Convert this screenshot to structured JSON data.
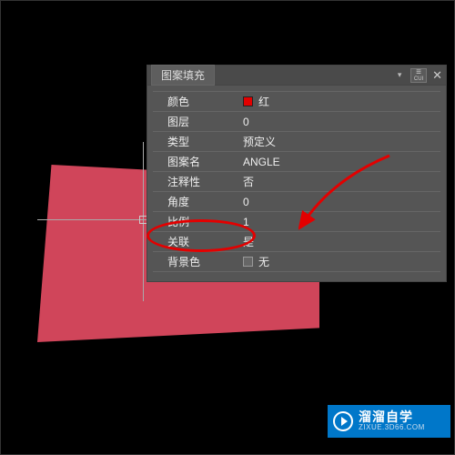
{
  "panel": {
    "title": "图案填充",
    "cui": "CUI",
    "rows": [
      {
        "label": "颜色",
        "value": "红",
        "swatch": true
      },
      {
        "label": "图层",
        "value": "0"
      },
      {
        "label": "类型",
        "value": "预定义"
      },
      {
        "label": "图案名",
        "value": "ANGLE"
      },
      {
        "label": "注释性",
        "value": "否"
      },
      {
        "label": "角度",
        "value": "0"
      },
      {
        "label": "比例",
        "value": "1"
      },
      {
        "label": "关联",
        "value": "是"
      },
      {
        "label": "背景色",
        "value": "无",
        "checkbox": true
      }
    ]
  },
  "watermark": {
    "title": "溜溜自学",
    "url": "ZIXUE.3D66.COM"
  },
  "colors": {
    "accent": "#e30000",
    "shape": "#d0455a"
  }
}
